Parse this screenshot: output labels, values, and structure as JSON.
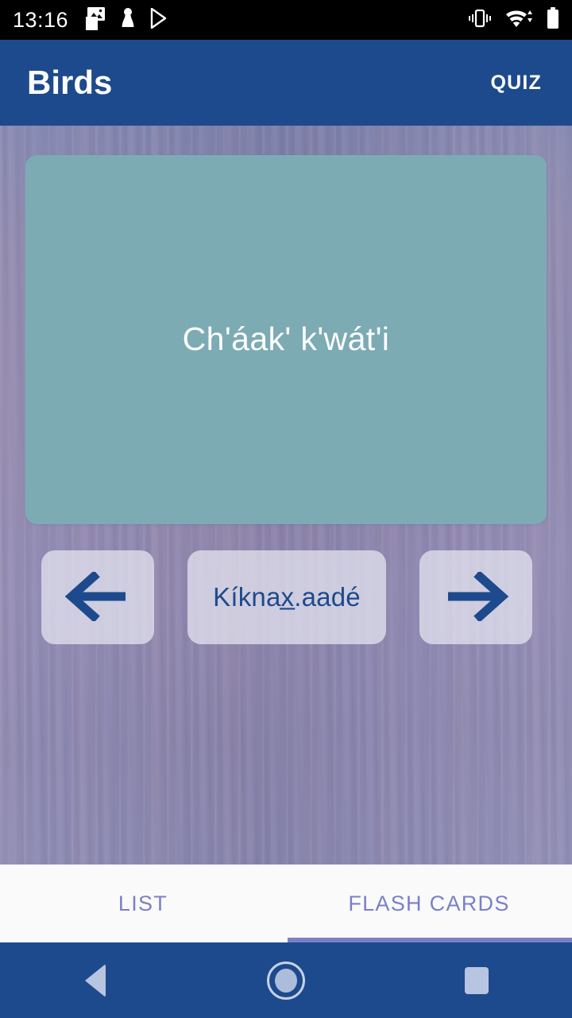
{
  "status_bar": {
    "time": "13:16",
    "left_icons": [
      {
        "name": "photo-icon",
        "label": "image"
      },
      {
        "name": "pawn-icon",
        "label": "app"
      },
      {
        "name": "play-store-icon",
        "label": "play-store"
      }
    ],
    "right_icons": [
      {
        "name": "vibrate-icon",
        "label": "vibrate"
      },
      {
        "name": "wifi-icon",
        "label": "wifi"
      },
      {
        "name": "battery-icon",
        "label": "battery"
      }
    ]
  },
  "app_bar": {
    "title": "Birds",
    "action_label": "QUIZ",
    "background_color": "#1d4a8c"
  },
  "flashcard": {
    "term": "Ch'áak' k'wát'i",
    "background_color": "#7cabb4",
    "text_color": "#ffffff"
  },
  "controls": {
    "previous_label": "←",
    "previous_name": "previous-card-button",
    "word_label": "Kíknax̲.aadé",
    "next_label": "→",
    "next_name": "next-card-button",
    "button_color": "#e9e9f3",
    "arrow_color": "#1d4a8c"
  },
  "tabs": {
    "items": [
      {
        "label": "LIST",
        "active": false
      },
      {
        "label": "FLASH CARDS",
        "active": true
      }
    ],
    "active_color": "#7b80c6",
    "background_color": "#fafafa"
  },
  "nav_bar": {
    "back_label": "back",
    "home_label": "home",
    "recents_label": "recents",
    "background_color": "#1d4a8c"
  }
}
